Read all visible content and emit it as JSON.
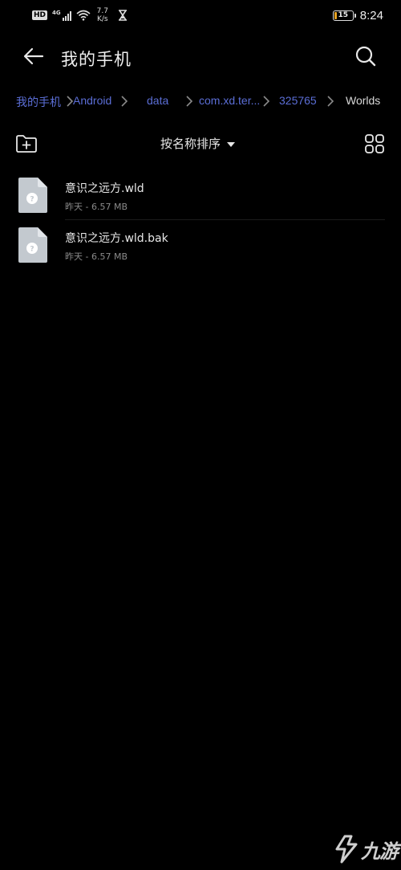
{
  "status_bar": {
    "hd_label": "HD",
    "network_type": "4G",
    "speed_value": "7.7",
    "speed_unit": "K/s",
    "battery_level": "15",
    "time": "8:24"
  },
  "app_bar": {
    "title": "我的手机"
  },
  "breadcrumb": {
    "items": [
      "我的手机",
      "Android",
      "data",
      "com.xd.ter...",
      "325765",
      "Worlds"
    ]
  },
  "toolbar": {
    "sort_label": "按名称排序"
  },
  "files": [
    {
      "name": "意识之远方.wld",
      "meta": "昨天 - 6.57 MB"
    },
    {
      "name": "意识之远方.wld.bak",
      "meta": "昨天 - 6.57 MB"
    }
  ],
  "watermark": {
    "text": "九游"
  },
  "colors": {
    "background": "#000000",
    "breadcrumb_link": "#5b6ed6",
    "file_icon": "#c3c9cf",
    "battery_fill": "#e8a321"
  },
  "icons": {
    "back": "arrow-left-icon",
    "search": "search-icon",
    "new_folder": "folder-plus-icon",
    "sort": "caret-down-icon",
    "grid": "grid-view-icon",
    "file": "unknown-file-icon"
  }
}
